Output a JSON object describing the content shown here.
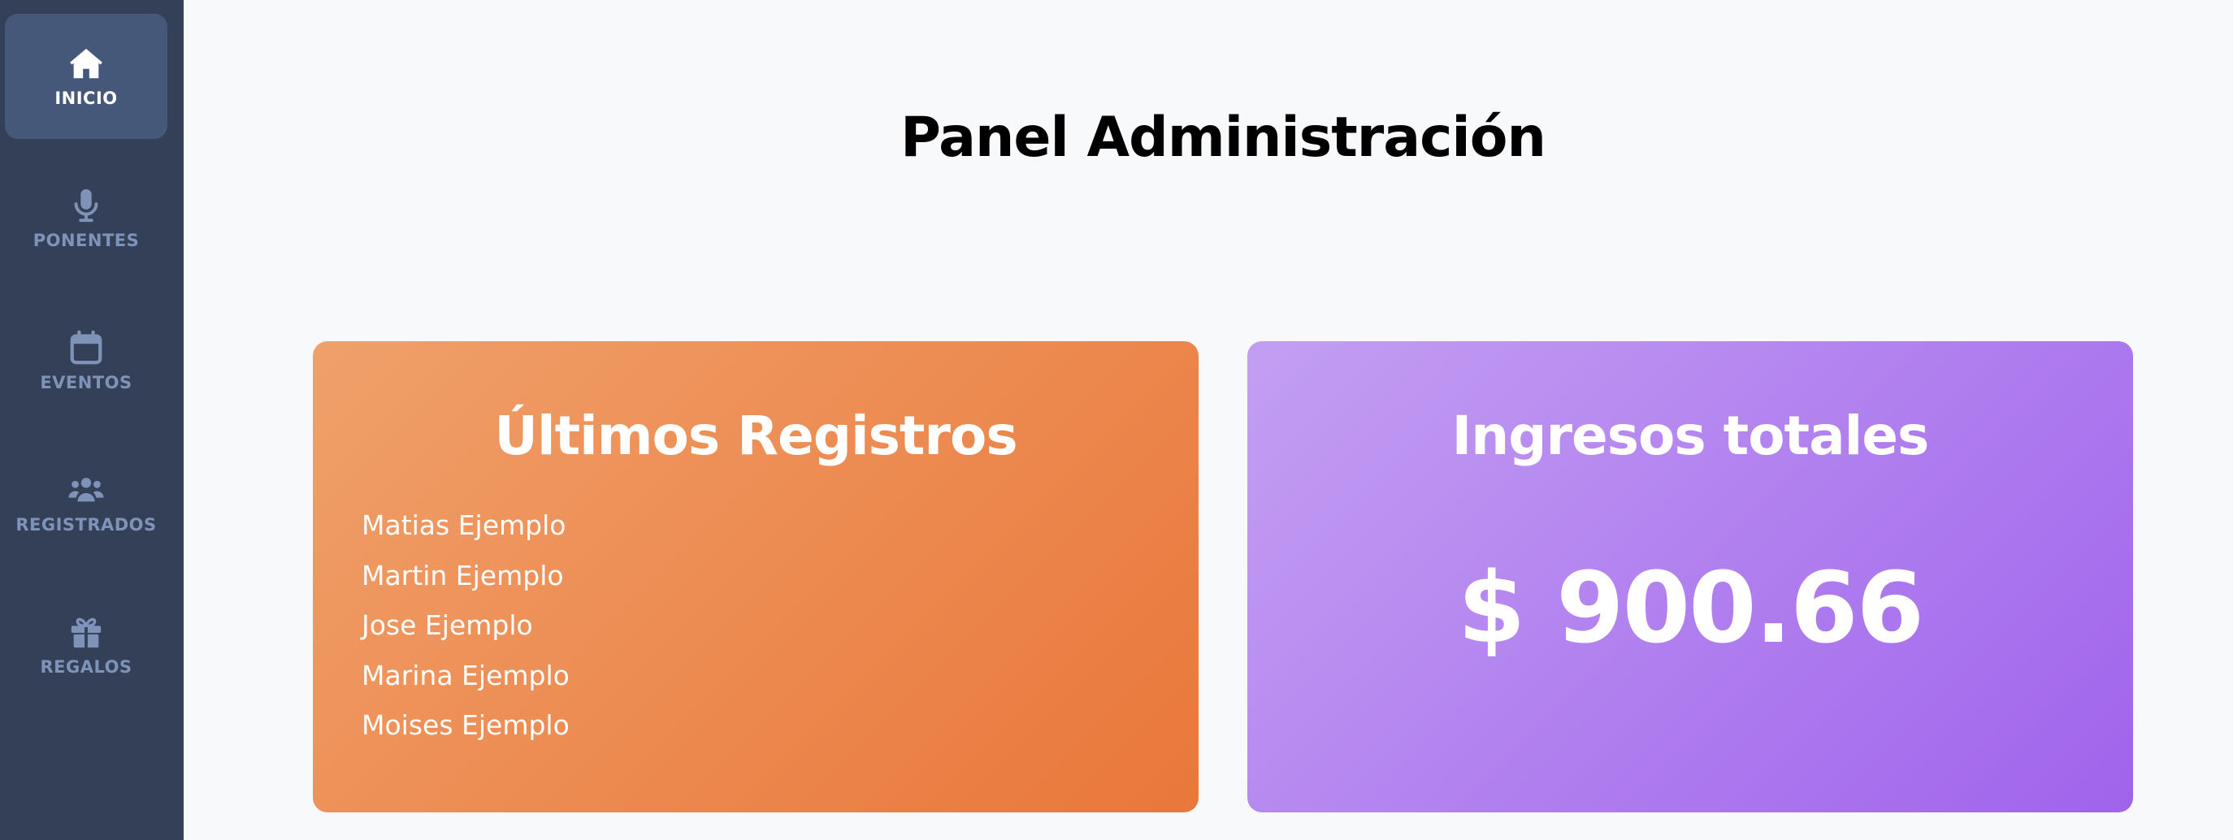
{
  "nav": {
    "items": [
      {
        "label": "Inicio",
        "icon": "home-icon",
        "active": true
      },
      {
        "label": "Ponentes",
        "icon": "microphone-icon",
        "active": false
      },
      {
        "label": "Eventos",
        "icon": "calendar-icon",
        "active": false
      },
      {
        "label": "Registrados",
        "icon": "users-icon",
        "active": false
      },
      {
        "label": "Regalos",
        "icon": "gift-icon",
        "active": false
      }
    ]
  },
  "page": {
    "title": "Panel Administración"
  },
  "registros": {
    "title": "Últimos Registros",
    "items": [
      "Matias Ejemplo",
      "Martin Ejemplo",
      "Jose Ejemplo",
      "Marina Ejemplo",
      "Moises Ejemplo"
    ]
  },
  "ingresos": {
    "title": "Ingresos totales",
    "amount": "$ 900.66"
  },
  "colors": {
    "sidebar": "#334058",
    "nav_active": "#46587a",
    "nav_inactive_text": "#7f93b8",
    "orange_start": "#f0a06a",
    "orange_end": "#e9773a",
    "purple_start": "#c39ff2",
    "purple_end": "#a063ec",
    "background": "#f8f9fb"
  }
}
